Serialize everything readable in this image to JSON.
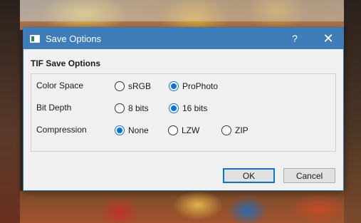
{
  "dialog": {
    "title": "Save Options",
    "help_label": "?",
    "close_label": "✕",
    "section_title": "TIF Save Options"
  },
  "options": {
    "color_space": {
      "label": "Color Space",
      "choices": [
        "sRGB",
        "ProPhoto"
      ],
      "selected": "ProPhoto"
    },
    "bit_depth": {
      "label": "Bit Depth",
      "choices": [
        "8 bits",
        "16 bits"
      ],
      "selected": "16 bits"
    },
    "compression": {
      "label": "Compression",
      "choices": [
        "None",
        "LZW",
        "ZIP"
      ],
      "selected": "None"
    }
  },
  "buttons": {
    "ok": "OK",
    "cancel": "Cancel"
  },
  "colors": {
    "titlebar": "#3f7dba",
    "accent": "#0a74d6",
    "dialog_bg": "#f0f0f0"
  },
  "icons": {
    "app": "image-window-icon",
    "help": "help-icon",
    "close": "close-icon"
  }
}
